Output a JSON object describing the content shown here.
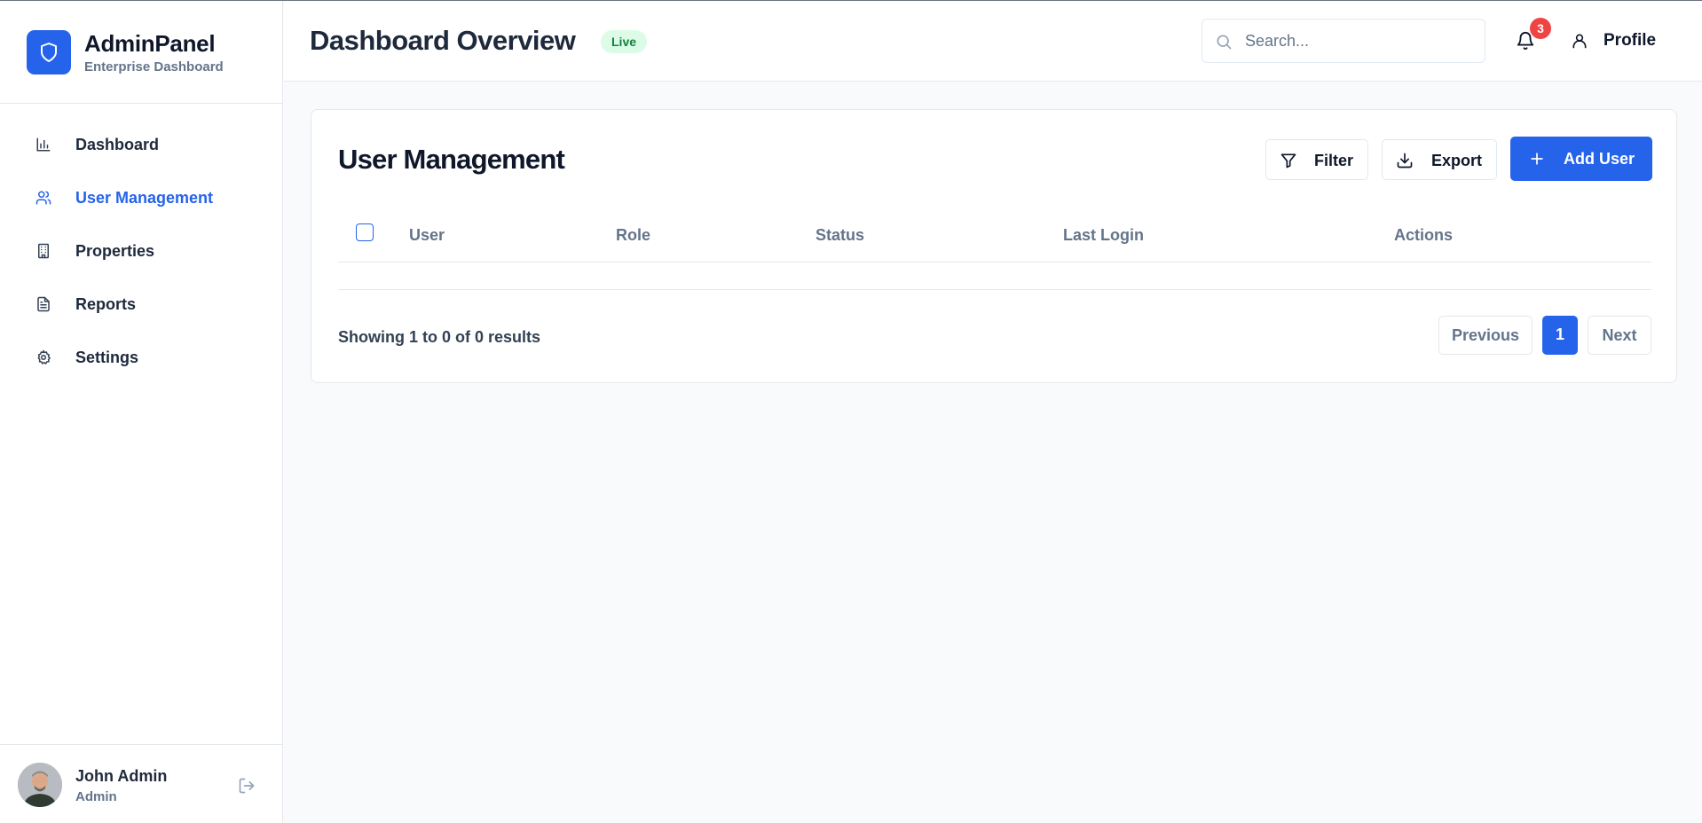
{
  "brand": {
    "title": "AdminPanel",
    "subtitle": "Enterprise Dashboard",
    "logo_icon": "shield-icon",
    "accent": "#2563eb"
  },
  "sidebar": {
    "items": [
      {
        "label": "Dashboard",
        "icon": "bar-chart-icon",
        "active": false
      },
      {
        "label": "User Management",
        "icon": "users-icon",
        "active": true
      },
      {
        "label": "Properties",
        "icon": "building-icon",
        "active": false
      },
      {
        "label": "Reports",
        "icon": "document-icon",
        "active": false
      },
      {
        "label": "Settings",
        "icon": "gear-icon",
        "active": false
      }
    ],
    "user": {
      "name": "John Admin",
      "role": "Admin"
    }
  },
  "header": {
    "title": "Dashboard Overview",
    "badge": "Live",
    "search": {
      "placeholder": "Search...",
      "value": ""
    },
    "notifications_count": "3",
    "profile_label": "Profile"
  },
  "main": {
    "card_title": "User Management",
    "buttons": {
      "filter": "Filter",
      "export": "Export",
      "add_user": "Add User"
    },
    "table": {
      "columns": [
        "User",
        "Role",
        "Status",
        "Last Login",
        "Actions"
      ],
      "rows": []
    },
    "results_text": "Showing 1 to 0 of 0 results",
    "pagination": {
      "previous": "Previous",
      "current_page": "1",
      "next": "Next"
    }
  }
}
